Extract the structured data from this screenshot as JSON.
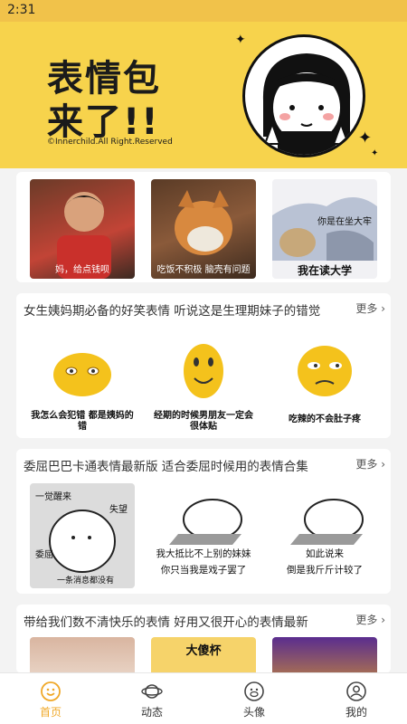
{
  "status": {
    "time": "2:31"
  },
  "banner": {
    "line1": "表情包",
    "line2": "来了!!",
    "copyright": "©Innerchild.All Right.Reserved"
  },
  "top_row": {
    "items": [
      {
        "caption": "妈，给点钱呗"
      },
      {
        "caption": "吃饭不积极 脑壳有问题"
      },
      {
        "caption_top": "你是在坐大牢",
        "caption_bottom": "我在读大学"
      }
    ]
  },
  "sections": [
    {
      "title": "女生姨妈期必备的好笑表情 听说这是生理期妹子的错觉",
      "more": "更多",
      "items": [
        {
          "text": "我怎么会犯错 都是姨妈的错"
        },
        {
          "text": "经期的时候男朋友一定会 很体贴"
        },
        {
          "text": "吃辣的不会肚子疼"
        }
      ]
    },
    {
      "title": "委屈巴巴卡通表情最新版 适合委屈时候用的表情合集",
      "more": "更多",
      "items": [
        {
          "t1": "一觉醒来",
          "t2": "失望",
          "t3": "委屈",
          "t4": "一条消息都没有"
        },
        {
          "line1": "我大抵比不上别的妹妹",
          "line2": "你只当我是戏子罢了"
        },
        {
          "line1": "如此说来",
          "line2": "倒是我斤斤计较了"
        }
      ]
    },
    {
      "title": "带给我们数不清快乐的表情 好用又很开心的表情最新",
      "more": "更多",
      "items": [
        {
          "text": ""
        },
        {
          "text": "大傻杯"
        },
        {
          "text": ""
        }
      ]
    }
  ],
  "tabbar": {
    "tabs": [
      {
        "label": "首页",
        "icon": "smile-icon",
        "active": true
      },
      {
        "label": "动态",
        "icon": "planet-icon",
        "active": false
      },
      {
        "label": "头像",
        "icon": "monkey-face-icon",
        "active": false
      },
      {
        "label": "我的",
        "icon": "user-icon",
        "active": false
      }
    ]
  },
  "colors": {
    "accent": "#f0a828",
    "banner": "#f7d34c"
  }
}
